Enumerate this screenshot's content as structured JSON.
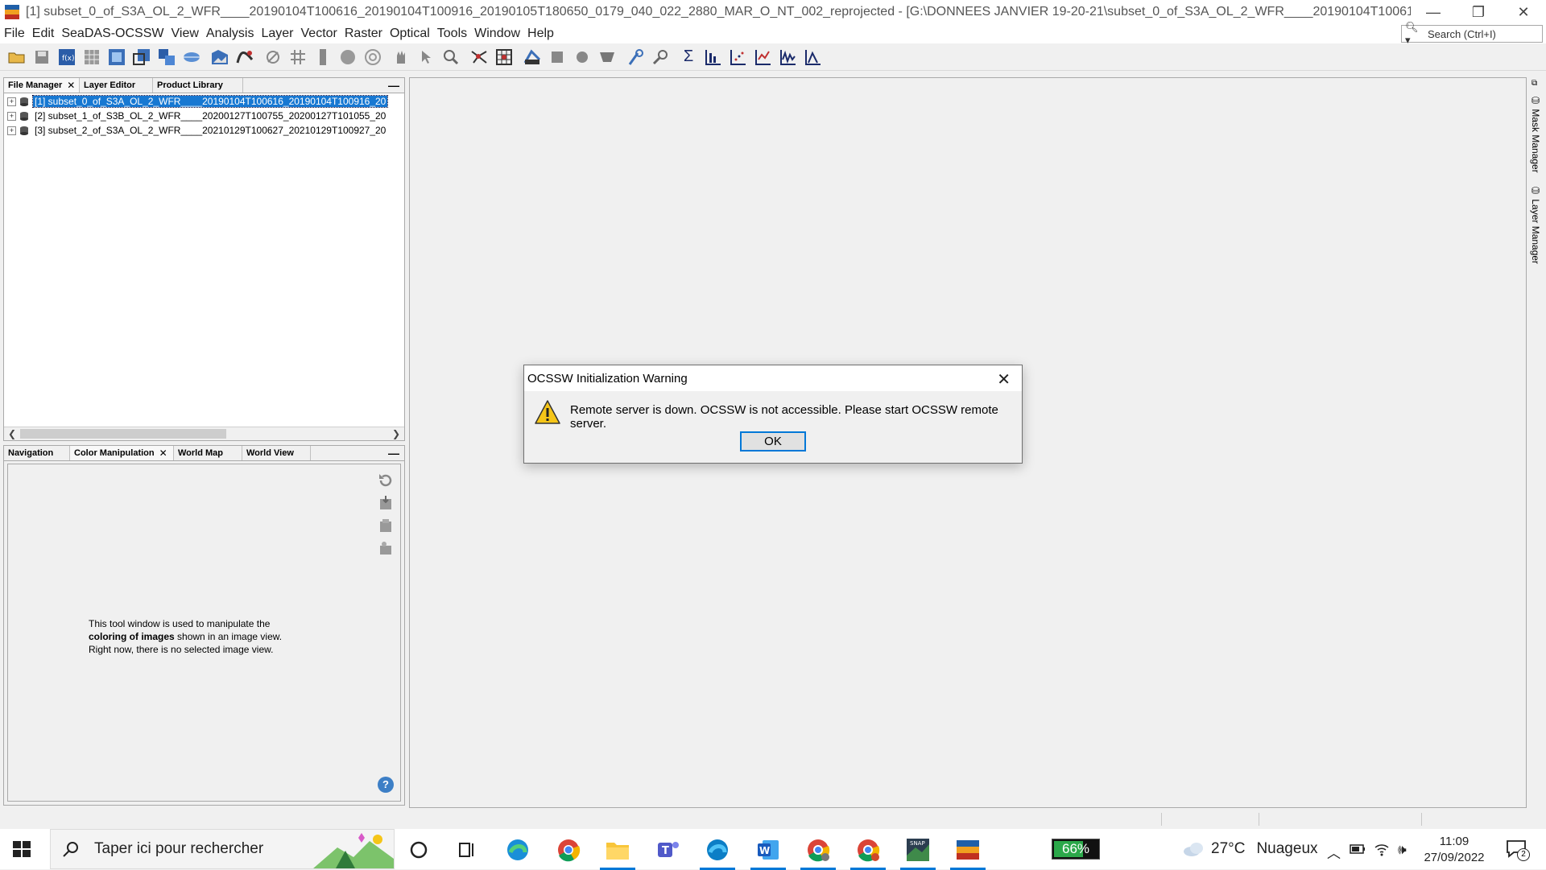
{
  "window": {
    "title": "[1] subset_0_of_S3A_OL_2_WFR____20190104T100616_20190104T100916_20190105T180650_0179_040_022_2880_MAR_O_NT_002_reprojected - [G:\\DONNEES JANVIER 19-20-21\\subset_0_of_S3A_OL_2_WFR____20190104T100616_20190104T100916_20190105T1...",
    "minimize": "—",
    "restore": "❐",
    "close": "✕"
  },
  "menu": {
    "items": [
      "File",
      "Edit",
      "SeaDAS-OCSSW",
      "View",
      "Analysis",
      "Layer",
      "Vector",
      "Raster",
      "Optical",
      "Tools",
      "Window",
      "Help"
    ],
    "search_placeholder": "Search (Ctrl+I)"
  },
  "file_manager": {
    "tabs": [
      "File Manager",
      "Layer Editor",
      "Product Library"
    ],
    "minimize": "—",
    "products": [
      "[1] subset_0_of_S3A_OL_2_WFR____20190104T100616_20190104T100916_20",
      "[2] subset_1_of_S3B_OL_2_WFR____20200127T100755_20200127T101055_20",
      "[3] subset_2_of_S3A_OL_2_WFR____20210129T100627_20210129T100927_20"
    ]
  },
  "tool_panel": {
    "tabs": [
      "Navigation",
      "Color Manipulation",
      "World Map",
      "World View"
    ],
    "minimize": "—",
    "info_line1": "This tool window is used to manipulate the",
    "info_line2_bold": "coloring of images",
    "info_line2_rest": " shown in an image view.",
    "info_line3": "Right now, there is no selected image view.",
    "help": "?"
  },
  "right_sidebar": {
    "tabs": [
      "Mask Manager",
      "Layer Manager"
    ]
  },
  "dialog": {
    "title": "OCSSW Initialization Warning",
    "message": "Remote server is down. OCSSW is not accessible. Please start OCSSW remote server.",
    "ok_label": "OK",
    "close": "✕"
  },
  "taskbar": {
    "search_placeholder": "Taper ici pour rechercher",
    "battery": "66%",
    "battery_level": 0.66,
    "temperature": "27°C",
    "weather": "Nuageux",
    "time": "11:09",
    "date": "27/09/2022",
    "notification_count": "2"
  },
  "colors": {
    "selection": "#1778d2",
    "accent": "#0078d7",
    "battery_green": "#2ba84a"
  }
}
